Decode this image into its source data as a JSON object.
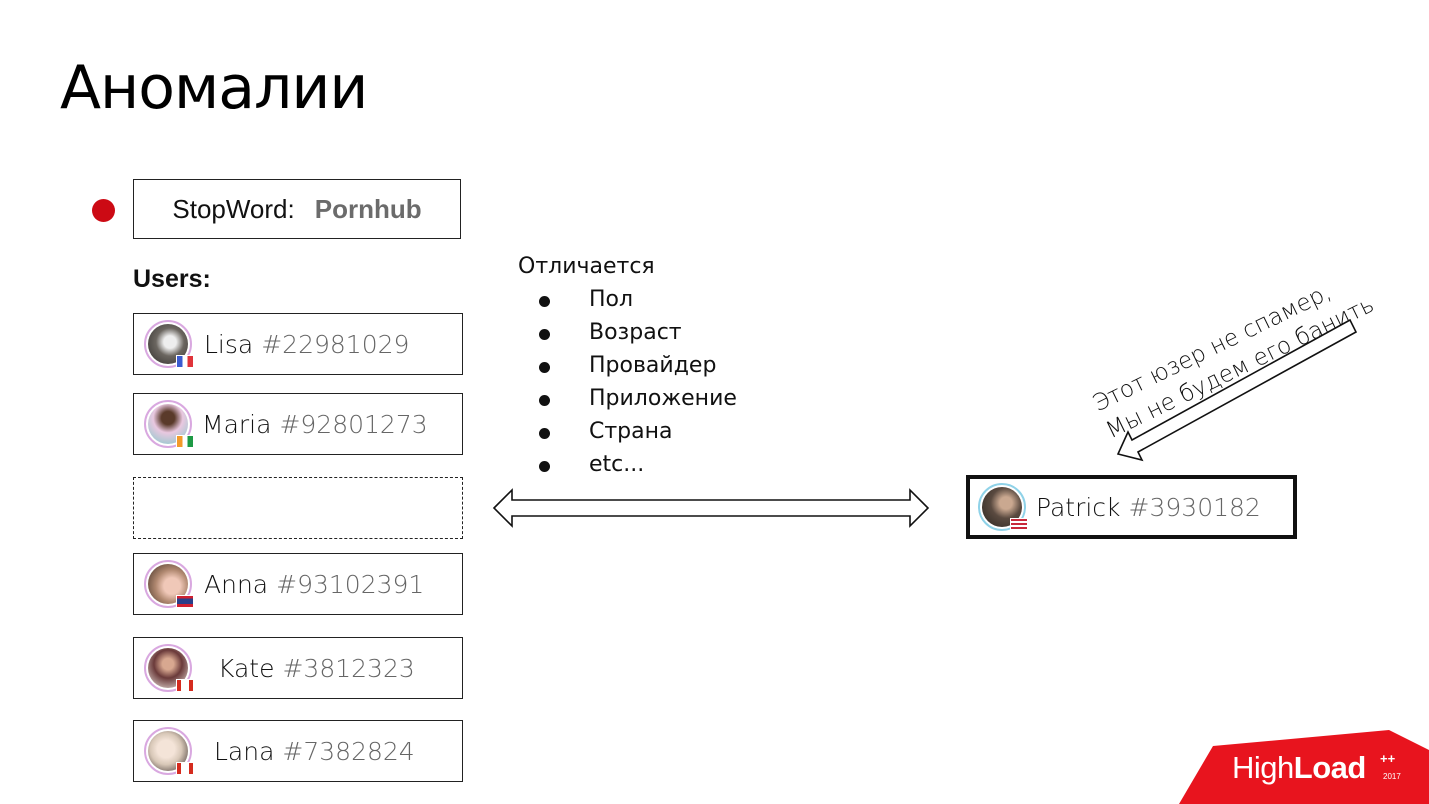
{
  "slide": {
    "title": "Аномалии"
  },
  "stopword": {
    "label": "StopWord:",
    "value": "Pornhub"
  },
  "users_label": "Users:",
  "users": [
    {
      "name": "Lisa",
      "id": "#22981029",
      "flag": "france-flag",
      "avatar_color": "#6b6660"
    },
    {
      "name": "Maria",
      "id": "#92801273",
      "flag": "ivory-coast-flag",
      "avatar_color": "#7fc9c9"
    },
    {
      "name": "",
      "id": "",
      "flag": "",
      "avatar_color": "",
      "empty": true
    },
    {
      "name": "Anna",
      "id": "#93102391",
      "flag": "laos-flag",
      "avatar_color": "#b08870"
    },
    {
      "name": "Kate",
      "id": "#3812323",
      "flag": "canada-flag",
      "avatar_color": "#6a3a3a"
    },
    {
      "name": "Lana",
      "id": "#7382824",
      "flag": "canada-flag",
      "avatar_color": "#d8c8b8"
    }
  ],
  "differences": {
    "heading": "Отличается",
    "items": [
      "Пол",
      "Возраст",
      "Провайдер",
      "Приложение",
      "Страна",
      "etc..."
    ]
  },
  "patrick": {
    "name": "Patrick",
    "id": "#3930182",
    "flag": "usa-flag",
    "avatar_color": "#5a4a40"
  },
  "note": {
    "line1": "Этот юзер не спамер,",
    "line2": "Мы не будем его банить"
  },
  "logo": {
    "high": "High",
    "load": "Load",
    "plus": "++",
    "year": "2017",
    "color": "#e8141e"
  },
  "colors": {
    "accent_red": "#cc0a14"
  }
}
